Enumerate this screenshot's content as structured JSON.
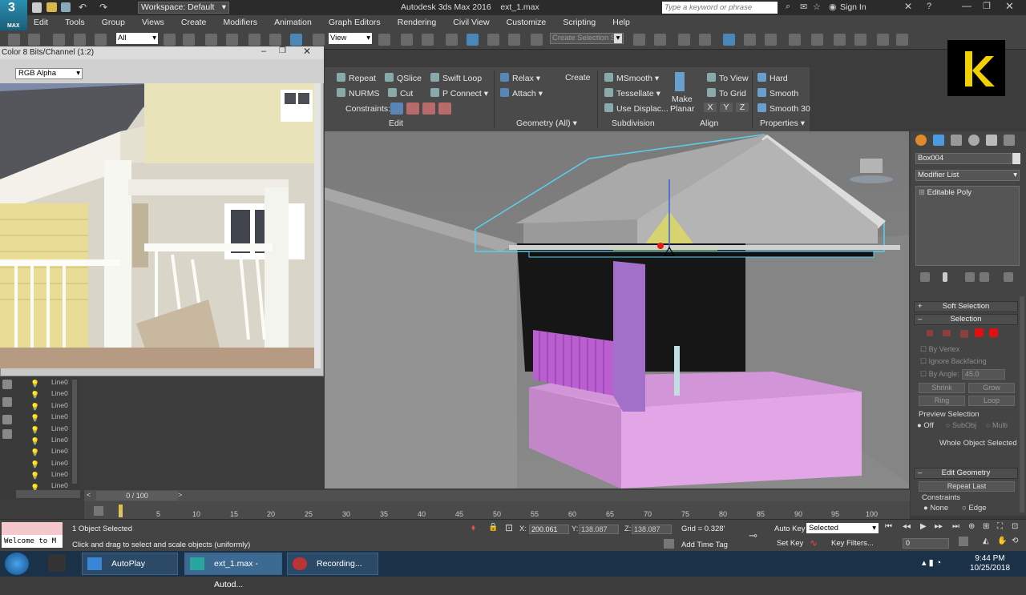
{
  "titlebar": {
    "logo_text": "3",
    "logo_sub": "MAX",
    "workspace": "Workspace: Default",
    "app_title": "Autodesk 3ds Max 2016",
    "file_name": "ext_1.max",
    "search_placeholder": "Type a keyword or phrase",
    "sign_in": "Sign In"
  },
  "menu": [
    "Edit",
    "Tools",
    "Group",
    "Views",
    "Create",
    "Modifiers",
    "Animation",
    "Graph Editors",
    "Rendering",
    "Civil View",
    "Customize",
    "Scripting",
    "Help"
  ],
  "toolbar": {
    "selection_filter": "All",
    "ref_coord": "View",
    "named_selection_placeholder": "Create Selection Se"
  },
  "framebuffer": {
    "title": "Color 8 Bits/Channel (1:2)",
    "channel": "RGB Alpha"
  },
  "ribbon": {
    "edit": {
      "repeat": "Repeat",
      "qslice": "QSlice",
      "swift_loop": "Swift Loop",
      "nurms": "NURMS",
      "cut": "Cut",
      "p_connect": "P Connect",
      "constraints": "Constraints:",
      "label": "Edit"
    },
    "geometry": {
      "relax": "Relax",
      "create": "Create",
      "attach": "Attach",
      "label": "Geometry (All)"
    },
    "subdivision": {
      "msmooth": "MSmooth",
      "tessellate": "Tessellate",
      "use_displac": "Use Displac...",
      "label": "Subdivision"
    },
    "align": {
      "make": "Make",
      "planar": "Planar",
      "to_view": "To View",
      "to_grid": "To Grid",
      "x": "X",
      "y": "Y",
      "z": "Z",
      "label": "Align"
    },
    "properties": {
      "hard": "Hard",
      "smooth": "Smooth",
      "smooth30": "Smooth 30",
      "label": "Properties"
    }
  },
  "command_panel": {
    "object_name": "Box004",
    "modifier_list": "Modifier List",
    "stack_item": "Editable Poly",
    "soft_selection": "Soft Selection",
    "selection": "Selection",
    "by_vertex": "By Vertex",
    "ignore_backfacing": "Ignore Backfacing",
    "by_angle": "By Angle:",
    "angle_value": "45.0",
    "shrink": "Shrink",
    "grow": "Grow",
    "ring": "Ring",
    "loop": "Loop",
    "preview_selection": "Preview Selection",
    "off": "Off",
    "subobj": "SubObj",
    "multi": "Multi",
    "whole_object_selected": "Whole Object Selected",
    "edit_geometry": "Edit Geometry",
    "repeat_last": "Repeat Last",
    "constraints": "Constraints",
    "none": "None",
    "edge": "Edge"
  },
  "scene_explorer": {
    "rows": [
      "Line0",
      "Line0",
      "Line0",
      "Line0",
      "Line0",
      "Line0",
      "Line0",
      "Line0",
      "Line0",
      "Line0"
    ]
  },
  "timeline": {
    "slider": "0 / 100",
    "ticks": [
      "0",
      "5",
      "10",
      "15",
      "20",
      "25",
      "30",
      "35",
      "40",
      "45",
      "50",
      "55",
      "60",
      "65",
      "70",
      "75",
      "80",
      "85",
      "90",
      "95",
      "100"
    ]
  },
  "status": {
    "selected": "1 Object Selected",
    "prompt": "Click and drag to select and scale objects (uniformly)",
    "welcome": "Welcome to M",
    "x_label": "X:",
    "x_value": "200.061",
    "y_label": "Y:",
    "y_value": "138.087",
    "z_label": "Z:",
    "z_value": "138.087",
    "grid": "Grid = 0.328'",
    "add_time_tag": "Add Time Tag",
    "auto_key": "Auto Key",
    "set_key": "Set Key",
    "key_selected": "Selected",
    "key_filters": "Key Filters...",
    "frame": "0"
  },
  "taskbar": {
    "autoplay": "AutoPlay",
    "max_task": "ext_1.max - Autod...",
    "recording": "Recording...",
    "time": "9:44 PM",
    "date": "10/25/2018"
  },
  "colors": {
    "accent": "#4db8e6",
    "selection_highlight": "#5ad0f0",
    "pink_object": "#e2a6e6",
    "purple_object": "#b95fcf"
  }
}
